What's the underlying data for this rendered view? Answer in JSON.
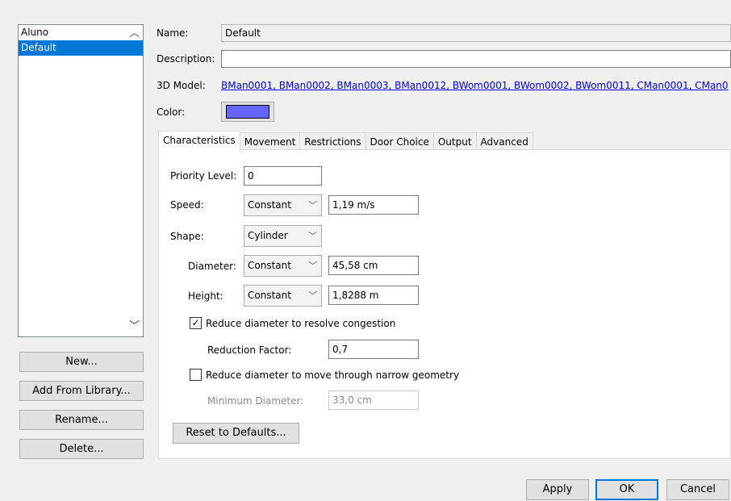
{
  "list": {
    "items": [
      {
        "label": "Aluno",
        "selected": false
      },
      {
        "label": "Default",
        "selected": true
      }
    ]
  },
  "left_buttons": {
    "new": "New...",
    "add_from_library": "Add From Library...",
    "rename": "Rename...",
    "delete": "Delete..."
  },
  "fields": {
    "name_label": "Name:",
    "name_value": "Default",
    "description_label": "Description:",
    "description_value": "",
    "model_label": "3D Model:",
    "model_value": "BMan0001, BMan0002, BMan0003, BMan0012, BWom0001, BWom0002, BWom0011, CMan0001, CMan0",
    "color_label": "Color:",
    "color_value": "#6464ff"
  },
  "tabs": [
    {
      "label": "Characteristics",
      "active": true
    },
    {
      "label": "Movement",
      "active": false
    },
    {
      "label": "Restrictions",
      "active": false
    },
    {
      "label": "Door Choice",
      "active": false
    },
    {
      "label": "Output",
      "active": false
    },
    {
      "label": "Advanced",
      "active": false
    }
  ],
  "characteristics": {
    "priority_label": "Priority Level:",
    "priority_value": "0",
    "speed_label": "Speed:",
    "speed_mode": "Constant",
    "speed_value": "1,19 m/s",
    "shape_label": "Shape:",
    "shape_value": "Cylinder",
    "diameter_label": "Diameter:",
    "diameter_mode": "Constant",
    "diameter_value": "45,58 cm",
    "height_label": "Height:",
    "height_mode": "Constant",
    "height_value": "1,8288 m",
    "reduce_congestion_label": "Reduce diameter to resolve congestion",
    "reduce_congestion_checked": true,
    "reduction_factor_label": "Reduction Factor:",
    "reduction_factor_value": "0,7",
    "reduce_narrow_label": "Reduce diameter to move through narrow geometry",
    "reduce_narrow_checked": false,
    "min_diameter_label": "Minimum Diameter:",
    "min_diameter_value": "33,0 cm",
    "reset_button": "Reset to Defaults..."
  },
  "dialog_buttons": {
    "apply": "Apply",
    "ok": "OK",
    "cancel": "Cancel"
  },
  "icons": {
    "scroll_up": "▲",
    "scroll_down": "▼",
    "dropdown": "chevron-down-icon",
    "check": "✓"
  }
}
